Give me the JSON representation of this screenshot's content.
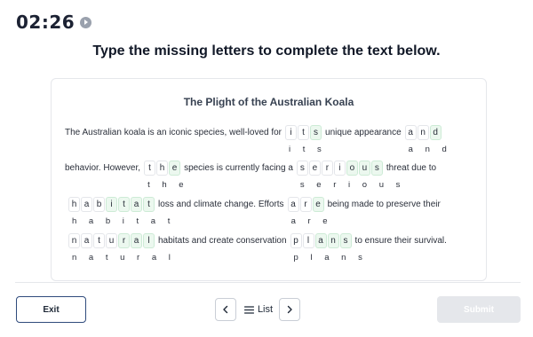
{
  "timer": {
    "value": "02:26",
    "icon": "play-icon"
  },
  "instruction": "Type the missing letters to complete the text below.",
  "passage": {
    "title": "The Plight of the Australian Koala",
    "lines": [
      [
        {
          "type": "text",
          "value": "The Australian koala is an iconic species, well-loved for"
        },
        {
          "type": "word",
          "id": "its",
          "letters": [
            "i",
            "t",
            "s"
          ],
          "typed": [
            false,
            false,
            true
          ]
        },
        {
          "type": "text",
          "value": "unique appearance"
        },
        {
          "type": "word",
          "id": "and",
          "letters": [
            "a",
            "n",
            "d"
          ],
          "typed": [
            false,
            false,
            true
          ]
        }
      ],
      [
        {
          "type": "text",
          "value": "behavior. However,"
        },
        {
          "type": "word",
          "id": "the",
          "letters": [
            "t",
            "h",
            "e"
          ],
          "typed": [
            false,
            false,
            true
          ]
        },
        {
          "type": "text",
          "value": "species is currently facing a"
        },
        {
          "type": "word",
          "id": "serious",
          "letters": [
            "s",
            "e",
            "r",
            "i",
            "o",
            "u",
            "s"
          ],
          "typed": [
            false,
            false,
            false,
            false,
            true,
            true,
            true
          ]
        },
        {
          "type": "text",
          "value": "threat due to"
        }
      ],
      [
        {
          "type": "word",
          "id": "habitat",
          "letters": [
            "h",
            "a",
            "b",
            "i",
            "t",
            "a",
            "t"
          ],
          "typed": [
            false,
            false,
            false,
            true,
            true,
            true,
            true
          ]
        },
        {
          "type": "text",
          "value": "loss and climate change. Efforts"
        },
        {
          "type": "word",
          "id": "are",
          "letters": [
            "a",
            "r",
            "e"
          ],
          "typed": [
            false,
            false,
            true
          ]
        },
        {
          "type": "text",
          "value": "being made to preserve their"
        }
      ],
      [
        {
          "type": "word",
          "id": "natural",
          "letters": [
            "n",
            "a",
            "t",
            "u",
            "r",
            "a",
            "l"
          ],
          "typed": [
            false,
            false,
            false,
            false,
            true,
            true,
            true
          ]
        },
        {
          "type": "text",
          "value": "habitats and create conservation"
        },
        {
          "type": "word",
          "id": "plans",
          "letters": [
            "p",
            "l",
            "a",
            "n",
            "s"
          ],
          "typed": [
            false,
            false,
            true,
            true,
            true
          ]
        },
        {
          "type": "text",
          "value": "to ensure their survival."
        }
      ]
    ],
    "answers": {
      "its": "i t s",
      "and": "a n d",
      "the": "t h e",
      "serious": "s e r i o u s",
      "habitat": "h a b i t a t",
      "are": "a r e",
      "natural": "n a t u r a l",
      "plans": "p l a n s"
    }
  },
  "footer": {
    "exit_label": "Exit",
    "list_label": "List",
    "submit_label": "Submit"
  }
}
